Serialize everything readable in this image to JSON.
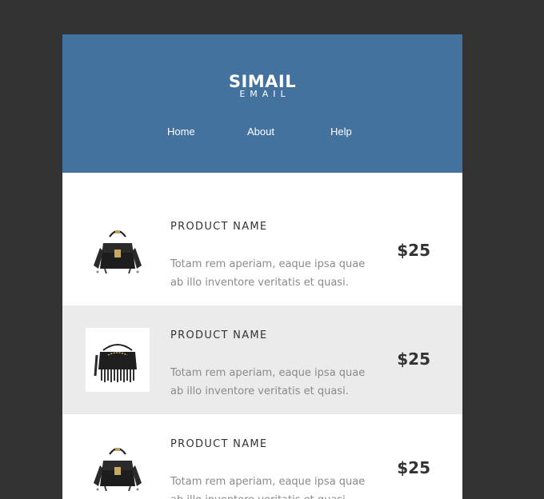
{
  "header": {
    "logo_title": "SIMAIL",
    "logo_subtitle": "EMAIL",
    "nav": [
      "Home",
      "About",
      "Help"
    ],
    "background": "#43729f"
  },
  "products": [
    {
      "name": "PRODUCT NAME",
      "description": "Totam rem aperiam, eaque ipsa quae ab illo inventore veritatis et quasi.",
      "price": "$25",
      "image": "handbag-icon"
    },
    {
      "name": "PRODUCT NAME",
      "description": "Totam rem aperiam, eaque ipsa quae ab illo inventore veritatis et quasi.",
      "price": "$25",
      "image": "fringe-bag-icon"
    },
    {
      "name": "PRODUCT NAME",
      "description": "Totam rem aperiam, eaque ipsa quae ab illo inventore veritatis et quasi.",
      "price": "$25",
      "image": "handbag-icon"
    }
  ],
  "colors": {
    "page_background": "#333333",
    "alt_row": "#ebebeb",
    "text_dark": "#333333",
    "text_muted": "#8a8a8a"
  }
}
